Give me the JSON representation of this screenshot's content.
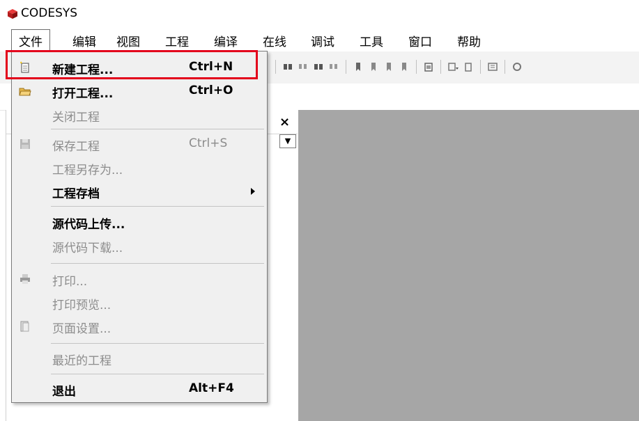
{
  "app": {
    "title": "CODESYS"
  },
  "menubar": {
    "items": [
      "文件",
      "编辑",
      "视图",
      "工程",
      "编译",
      "在线",
      "调试",
      "工具",
      "窗口",
      "帮助"
    ]
  },
  "file_menu": {
    "items": [
      {
        "label": "新建工程...",
        "shortcut": "Ctrl+N",
        "icon": "new-project-icon",
        "state": "bold"
      },
      {
        "label": "打开工程...",
        "shortcut": "Ctrl+O",
        "icon": "open-folder-icon",
        "state": "bold"
      },
      {
        "label": "关闭工程",
        "shortcut": "",
        "icon": "",
        "state": "disabled"
      },
      {
        "label": "保存工程",
        "shortcut": "Ctrl+S",
        "icon": "save-icon",
        "state": "disabled"
      },
      {
        "label": "工程另存为...",
        "shortcut": "",
        "icon": "",
        "state": "disabled"
      },
      {
        "label": "工程存档",
        "shortcut": "",
        "icon": "",
        "state": "bold",
        "submenu": true
      },
      {
        "label": "源代码上传...",
        "shortcut": "",
        "icon": "",
        "state": "bold"
      },
      {
        "label": "源代码下载...",
        "shortcut": "",
        "icon": "",
        "state": "disabled"
      },
      {
        "label": "打印...",
        "shortcut": "",
        "icon": "print-icon",
        "state": "disabled"
      },
      {
        "label": "打印预览...",
        "shortcut": "",
        "icon": "",
        "state": "disabled"
      },
      {
        "label": "页面设置...",
        "shortcut": "",
        "icon": "page-setup-icon",
        "state": "disabled"
      },
      {
        "label": "最近的工程",
        "shortcut": "",
        "icon": "",
        "state": "disabled"
      },
      {
        "label": "退出",
        "shortcut": "Alt+F4",
        "icon": "",
        "state": "bold"
      }
    ]
  },
  "panel": {
    "close_glyph": "×",
    "dropdown_glyph": "▼"
  },
  "colors": {
    "highlight": "#e3001b",
    "workspace": "#a6a6a6",
    "menu_bg": "#f0f0f0"
  }
}
